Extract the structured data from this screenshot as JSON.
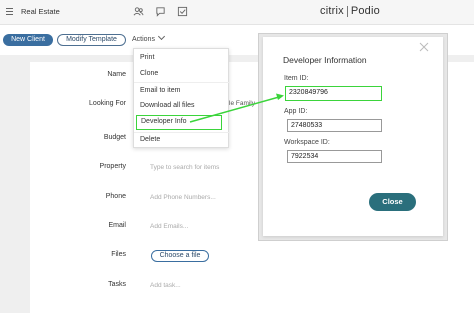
{
  "topbar": {
    "workspace_name": "Real Estate",
    "brand_left": "citrix",
    "brand_right": "Podio"
  },
  "toolbar": {
    "new_label": "New Client",
    "modify_label": "Modify Template",
    "actions_label": "Actions"
  },
  "form": {
    "name_label": "Name",
    "looking_for_label": "Looking For",
    "looking_for_chip_tail": "le Family",
    "budget_label": "Budget",
    "property_label": "Property",
    "property_placeholder": "Type to search for items",
    "phone_label": "Phone",
    "phone_placeholder": "Add Phone Numbers...",
    "email_label": "Email",
    "email_placeholder": "Add Emails...",
    "files_label": "Files",
    "choose_file_label": "Choose a file",
    "tasks_label": "Tasks",
    "tasks_placeholder": "Add task..."
  },
  "dropdown": {
    "items": [
      "Print",
      "Clone",
      "Email to item",
      "Download all files",
      "Developer Info",
      "Delete"
    ]
  },
  "dialog": {
    "title": "Developer Information",
    "item_id_label": "Item ID:",
    "item_id_value": "2320849796",
    "app_id_label": "App ID:",
    "app_id_value": "27480533",
    "workspace_id_label": "Workspace ID:",
    "workspace_id_value": "7922534",
    "close_label": "Close"
  },
  "colors": {
    "primary": "#3a6ea0",
    "highlight": "#3bd43b",
    "close_button": "#2a6f7c"
  }
}
